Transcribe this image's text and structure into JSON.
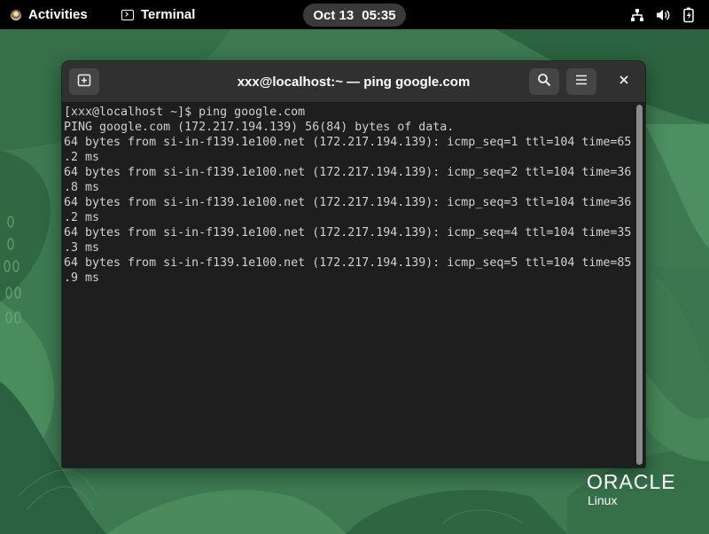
{
  "topbar": {
    "activities_label": "Activities",
    "app_name": "Terminal",
    "clock_date": "Oct 13",
    "clock_time": "05:35",
    "tray_icons": [
      "network-icon",
      "volume-icon",
      "battery-icon"
    ]
  },
  "window": {
    "title": "xxx@localhost:~ — ping google.com",
    "buttons": {
      "new_tab": "new-tab-icon",
      "search": "search-icon",
      "menu": "hamburger-menu-icon",
      "close": "close-icon"
    }
  },
  "terminal": {
    "lines": [
      "[xxx@localhost ~]$ ping google.com",
      "PING google.com (172.217.194.139) 56(84) bytes of data.",
      "64 bytes from si-in-f139.1e100.net (172.217.194.139): icmp_seq=1 ttl=104 time=65",
      ".2 ms",
      "64 bytes from si-in-f139.1e100.net (172.217.194.139): icmp_seq=2 ttl=104 time=36",
      ".8 ms",
      "64 bytes from si-in-f139.1e100.net (172.217.194.139): icmp_seq=3 ttl=104 time=36",
      ".2 ms",
      "64 bytes from si-in-f139.1e100.net (172.217.194.139): icmp_seq=4 ttl=104 time=35",
      ".3 ms",
      "64 bytes from si-in-f139.1e100.net (172.217.194.139): icmp_seq=5 ttl=104 time=85",
      ".9 ms"
    ]
  },
  "branding": {
    "logo_word": "ORACLE",
    "logo_sub": "Linux"
  },
  "colors": {
    "topbar_bg": "#000000",
    "terminal_bg": "#1e1e1e",
    "terminal_fg": "#d0d0d0",
    "headerbar_bg": "#303030",
    "wallpaper_green": "#3f7f55"
  }
}
